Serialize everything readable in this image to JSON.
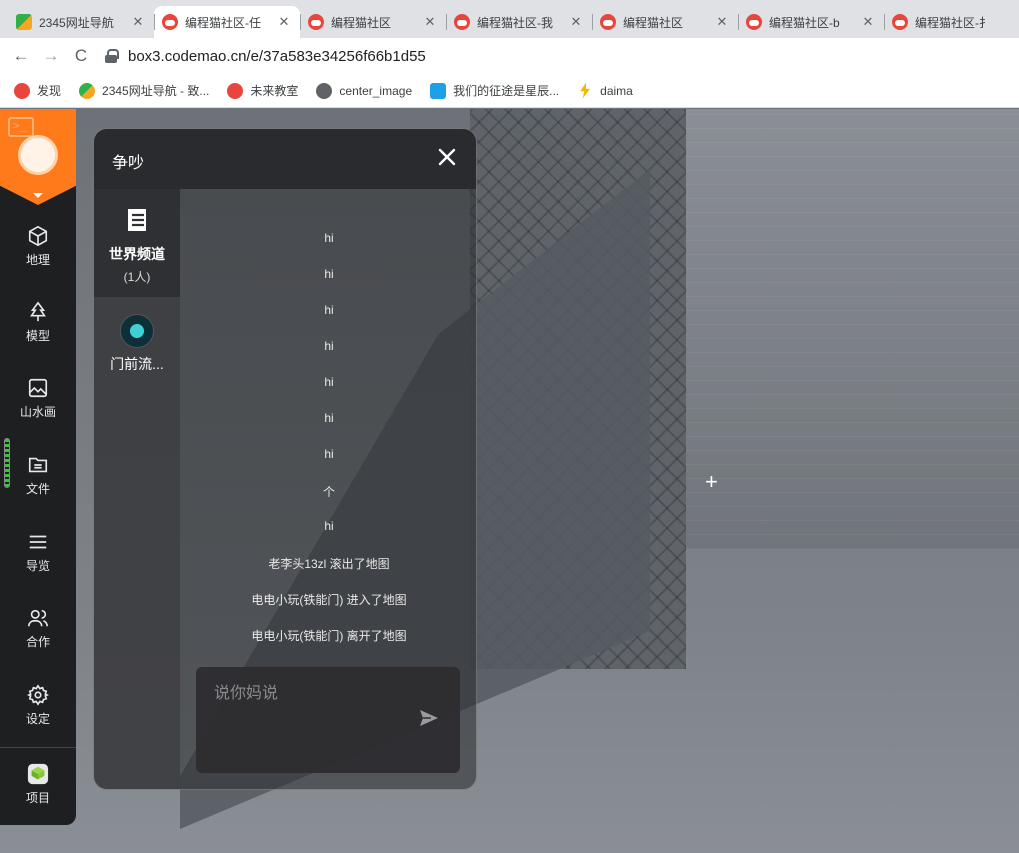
{
  "browser": {
    "tabs": [
      {
        "title": "2345网址导航",
        "favicon": "2345-icon",
        "active": false
      },
      {
        "title": "编程猫社区-任",
        "favicon": "codemao-icon",
        "active": true
      },
      {
        "title": "编程猫社区",
        "favicon": "codemao-icon",
        "active": false
      },
      {
        "title": "编程猫社区-我",
        "favicon": "codemao-icon",
        "active": false
      },
      {
        "title": "编程猫社区",
        "favicon": "codemao-icon",
        "active": false
      },
      {
        "title": "编程猫社区-b",
        "favicon": "codemao-icon",
        "active": false
      },
      {
        "title": "编程猫社区-扌",
        "favicon": "codemao-icon",
        "active": false
      }
    ],
    "tab_close": "✕",
    "nav": {
      "back": "←",
      "forward": "→",
      "reload": "C"
    },
    "url": "box3.codemao.cn/e/37a583e34256f66b1d55",
    "bookmarks": [
      {
        "label": "发现",
        "icon": "codemao-icon"
      },
      {
        "label": "2345网址导航 - 致...",
        "icon": "2345-icon"
      },
      {
        "label": "未来教室",
        "icon": "red-circle-icon"
      },
      {
        "label": "center_image",
        "icon": "globe-icon"
      },
      {
        "label": "我们的征途是星辰...",
        "icon": "bilibili-icon"
      },
      {
        "label": "daima",
        "icon": "bolt-icon"
      }
    ]
  },
  "sidebar": {
    "items": [
      {
        "label": "地理",
        "icon": "cube-icon"
      },
      {
        "label": "模型",
        "icon": "tree-icon"
      },
      {
        "label": "山水画",
        "icon": "image-icon"
      },
      {
        "label": "文件",
        "icon": "folder-icon"
      },
      {
        "label": "导览",
        "icon": "list-icon"
      },
      {
        "label": "合作",
        "icon": "users-icon"
      },
      {
        "label": "设定",
        "icon": "gear-icon"
      },
      {
        "label": "项目",
        "icon": "project-icon"
      }
    ]
  },
  "chat": {
    "title": "争吵",
    "close": "✕",
    "channels": [
      {
        "name": "世界频道",
        "count": "(1人)",
        "icon": "world-channel-icon"
      },
      {
        "name": "门前流...",
        "icon": "user-avatar"
      }
    ],
    "messages": [
      {
        "text": "hi"
      },
      {
        "text": "hi"
      },
      {
        "text": "hi"
      },
      {
        "text": "hi"
      },
      {
        "text": "hi"
      },
      {
        "text": "hi"
      },
      {
        "text": "hi"
      },
      {
        "text": "个"
      },
      {
        "text": "hi"
      },
      {
        "text": "老李头13zl 滚出了地图"
      },
      {
        "text": "电电小玩(铁能门) 进入了地图"
      },
      {
        "text": "电电小玩(铁能门) 离开了地图"
      }
    ],
    "input_placeholder": "说你妈说",
    "input_value": ""
  },
  "colors": {
    "brand_orange": "#ff7a1a",
    "sidebar_bg": "#1e1f21",
    "panel_head": "#2a2b2e"
  }
}
